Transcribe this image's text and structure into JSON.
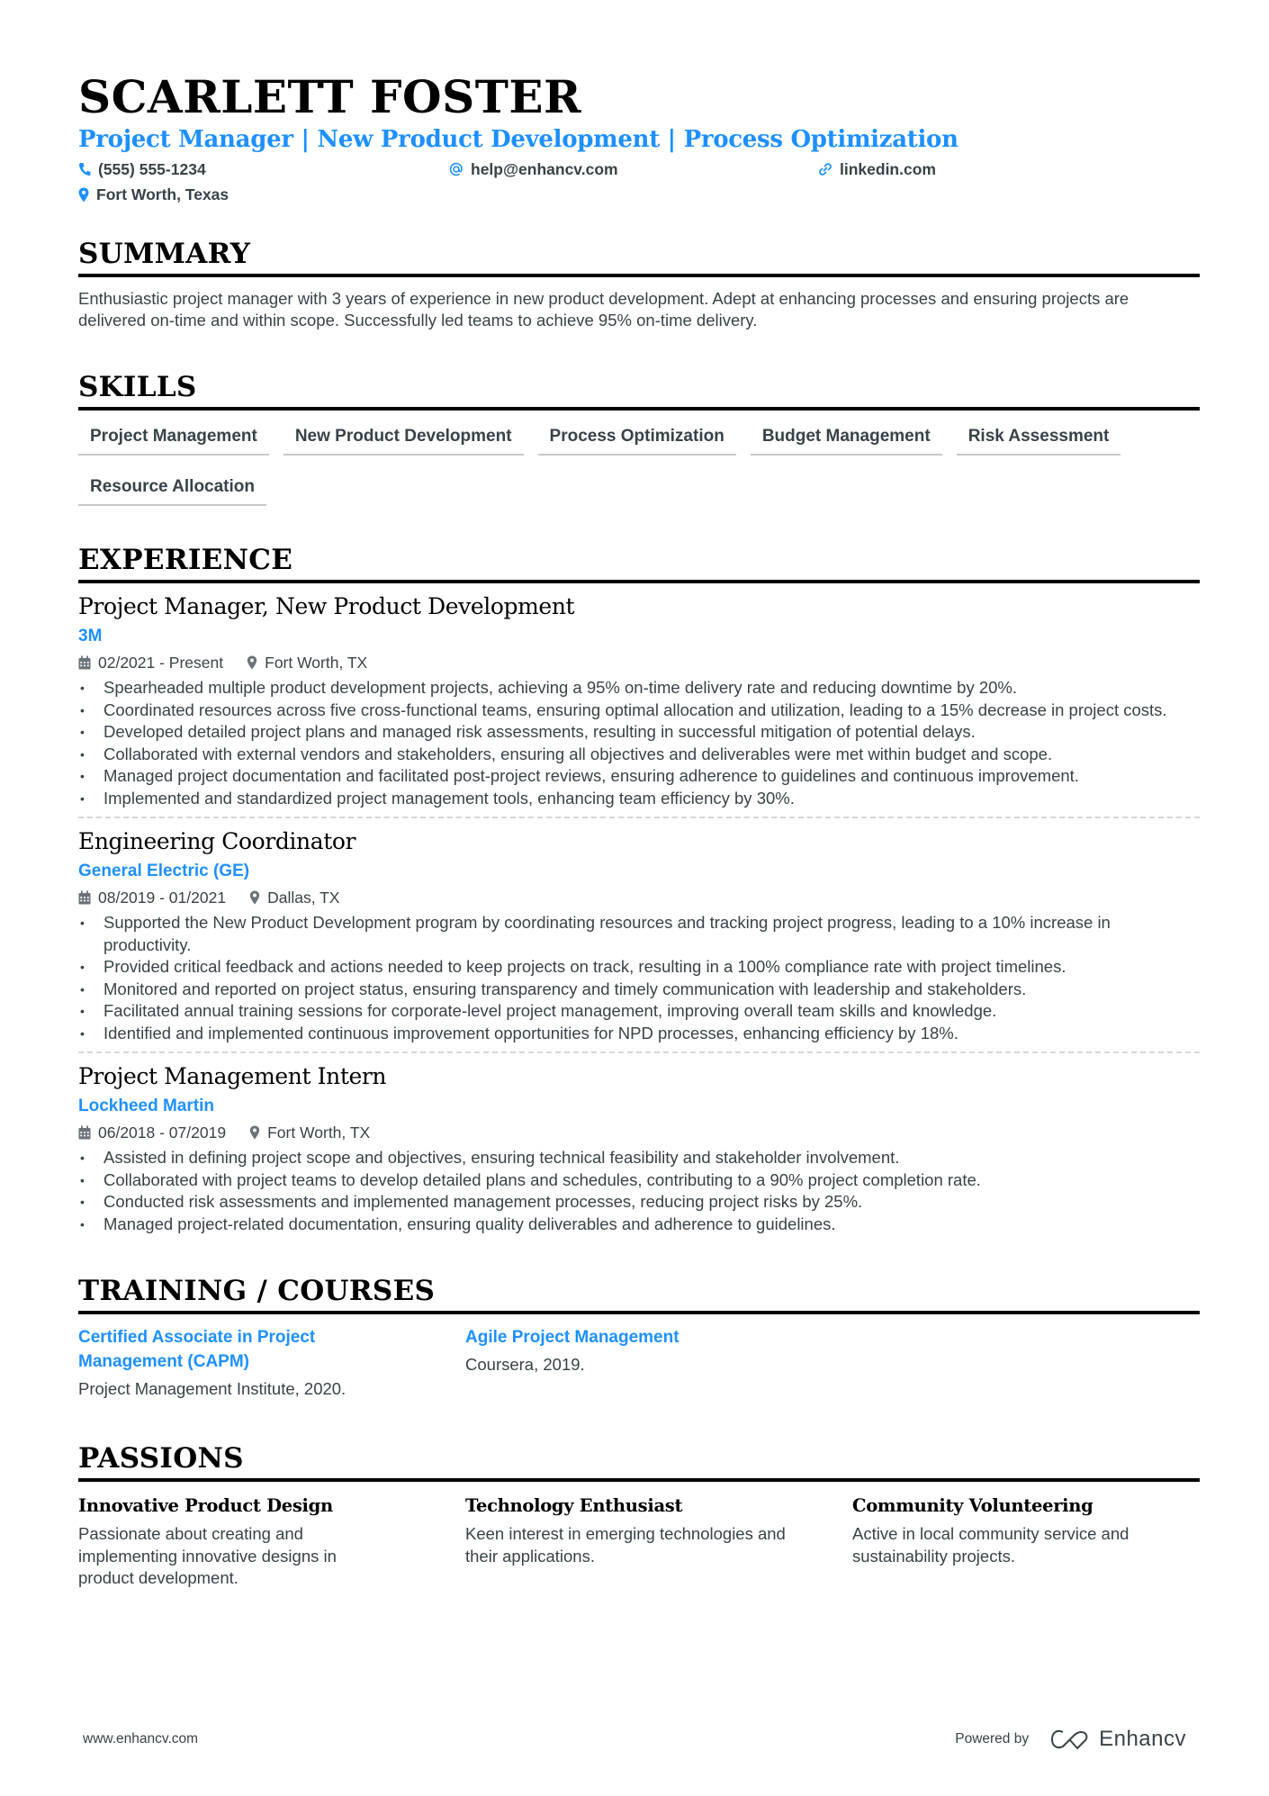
{
  "header": {
    "name": "SCARLETT FOSTER",
    "tagline": "Project Manager | New Product Development | Process Optimization",
    "contacts": {
      "phone": "(555) 555-1234",
      "email": "help@enhancv.com",
      "linkedin": "linkedin.com",
      "location": "Fort Worth, Texas"
    },
    "accent_color": "#1e90ff"
  },
  "summary": {
    "title": "SUMMARY",
    "text": "Enthusiastic project manager with 3 years of experience in new product development. Adept at enhancing processes and ensuring projects are delivered on-time and within scope. Successfully led teams to achieve 95% on-time delivery."
  },
  "skills": {
    "title": "SKILLS",
    "items": [
      "Project Management",
      "New Product Development",
      "Process Optimization",
      "Budget Management",
      "Risk Assessment",
      "Resource Allocation"
    ]
  },
  "experience": {
    "title": "EXPERIENCE",
    "jobs": [
      {
        "title": "Project Manager, New Product Development",
        "company": "3M",
        "dates": "02/2021 - Present",
        "location": "Fort Worth, TX",
        "bullets": [
          "Spearheaded multiple product development projects, achieving a 95% on-time delivery rate and reducing downtime by 20%.",
          "Coordinated resources across five cross-functional teams, ensuring optimal allocation and utilization, leading to a 15% decrease in project costs.",
          "Developed detailed project plans and managed risk assessments, resulting in successful mitigation of potential delays.",
          "Collaborated with external vendors and stakeholders, ensuring all objectives and deliverables were met within budget and scope.",
          "Managed project documentation and facilitated post-project reviews, ensuring adherence to guidelines and continuous improvement.",
          "Implemented and standardized project management tools, enhancing team efficiency by 30%."
        ]
      },
      {
        "title": "Engineering Coordinator",
        "company": "General Electric (GE)",
        "dates": "08/2019 - 01/2021",
        "location": "Dallas, TX",
        "bullets": [
          "Supported the New Product Development program by coordinating resources and tracking project progress, leading to a 10% increase in productivity.",
          "Provided critical feedback and actions needed to keep projects on track, resulting in a 100% compliance rate with project timelines.",
          "Monitored and reported on project status, ensuring transparency and timely communication with leadership and stakeholders.",
          "Facilitated annual training sessions for corporate-level project management, improving overall team skills and knowledge.",
          "Identified and implemented continuous improvement opportunities for NPD processes, enhancing efficiency by 18%."
        ]
      },
      {
        "title": "Project Management Intern",
        "company": "Lockheed Martin",
        "dates": "06/2018 - 07/2019",
        "location": "Fort Worth, TX",
        "bullets": [
          "Assisted in defining project scope and objectives, ensuring technical feasibility and stakeholder involvement.",
          "Collaborated with project teams to develop detailed plans and schedules, contributing to a 90% project completion rate.",
          "Conducted risk assessments and implemented management processes, reducing project risks by 25%.",
          "Managed project-related documentation, ensuring quality deliverables and adherence to guidelines."
        ]
      }
    ]
  },
  "training": {
    "title": "TRAINING / COURSES",
    "items": [
      {
        "title": "Certified Associate in Project Management (CAPM)",
        "desc": "Project Management Institute, 2020."
      },
      {
        "title": "Agile Project Management",
        "desc": "Coursera, 2019."
      }
    ]
  },
  "passions": {
    "title": "PASSIONS",
    "items": [
      {
        "title": "Innovative Product Design",
        "desc": "Passionate about creating and implementing innovative designs in product development."
      },
      {
        "title": "Technology Enthusiast",
        "desc": "Keen interest in emerging technologies and their applications."
      },
      {
        "title": "Community Volunteering",
        "desc": "Active in local community service and sustainability projects."
      }
    ]
  },
  "footer": {
    "website": "www.enhancv.com",
    "powered_by": "Powered by",
    "brand": "Enhancv"
  }
}
